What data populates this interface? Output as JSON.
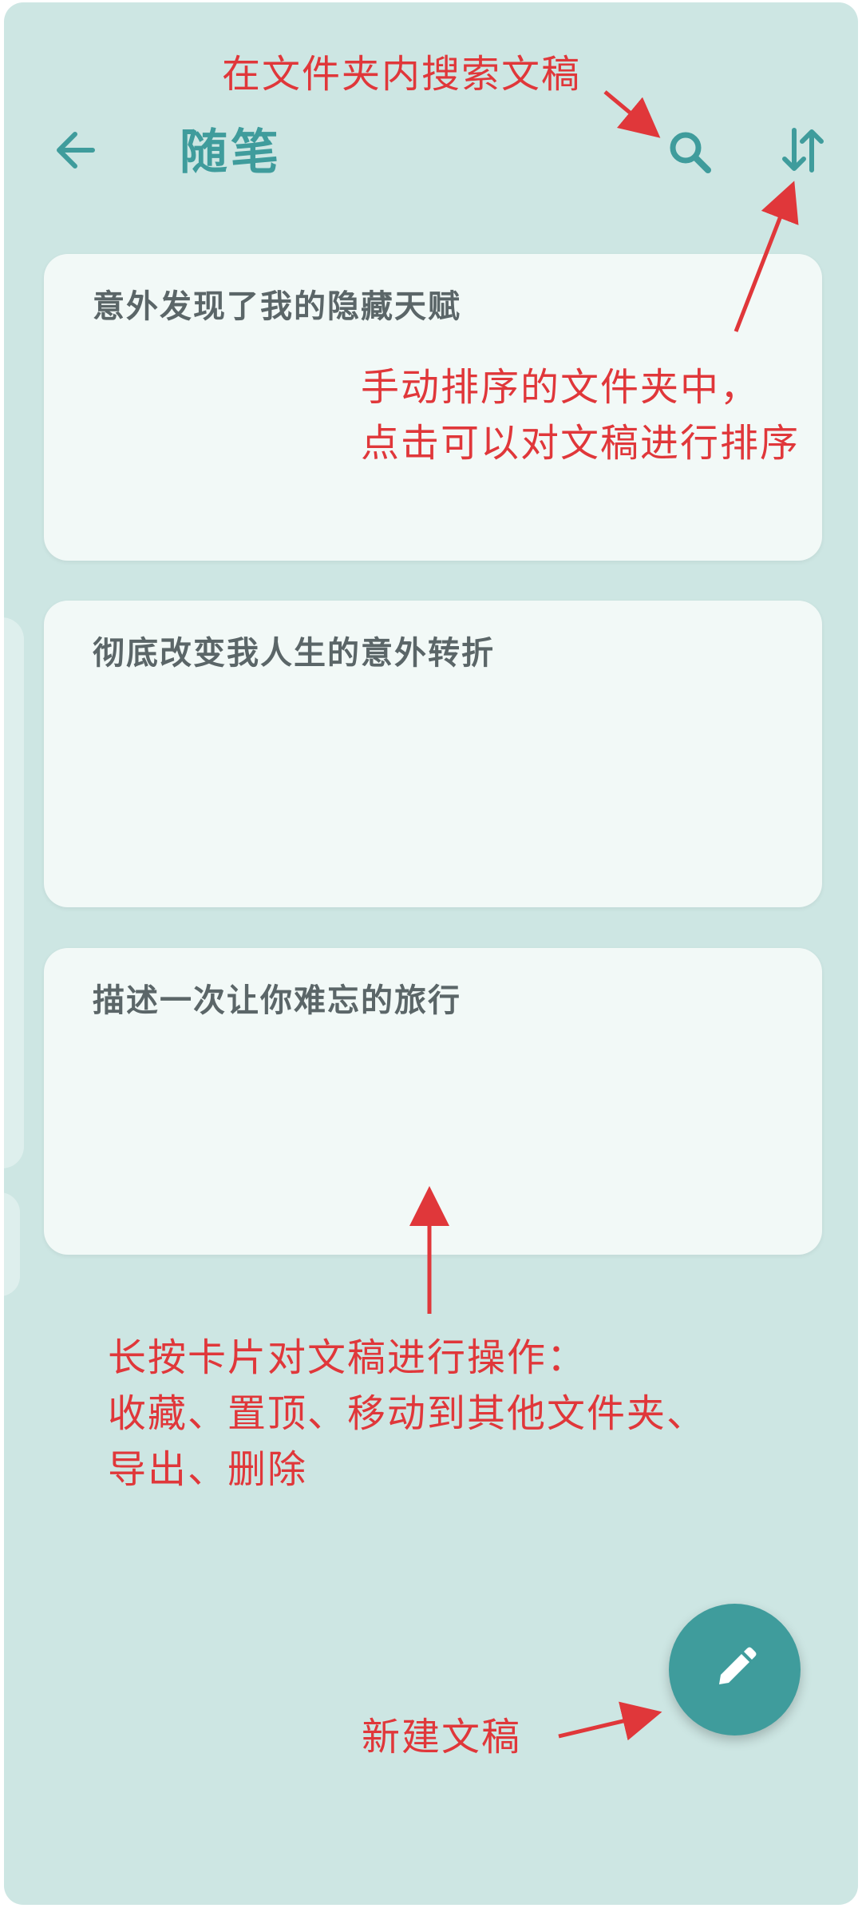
{
  "header": {
    "title": "随笔",
    "back_icon": "arrow-left-icon",
    "search_icon": "search-icon",
    "sort_icon": "sort-icon"
  },
  "cards": [
    {
      "title": "意外发现了我的隐藏天赋"
    },
    {
      "title": "彻底改变我人生的意外转折"
    },
    {
      "title": "描述一次让你难忘的旅行"
    }
  ],
  "annotations": {
    "search": "在文件夹内搜索文稿",
    "sort_line1": "手动排序的文件夹中，",
    "sort_line2": "点击可以对文稿进行排序",
    "long_press_line1": "长按卡片对文稿进行操作：",
    "long_press_line2": "收藏、置顶、移动到其他文件夹、",
    "long_press_line3": "导出、删除",
    "new_draft": "新建文稿"
  },
  "fab": {
    "icon": "pencil-icon"
  },
  "colors": {
    "background": "#cde6e3",
    "accent": "#3f9c9c",
    "card": "#f2f9f7",
    "annotation": "#e0373a"
  }
}
